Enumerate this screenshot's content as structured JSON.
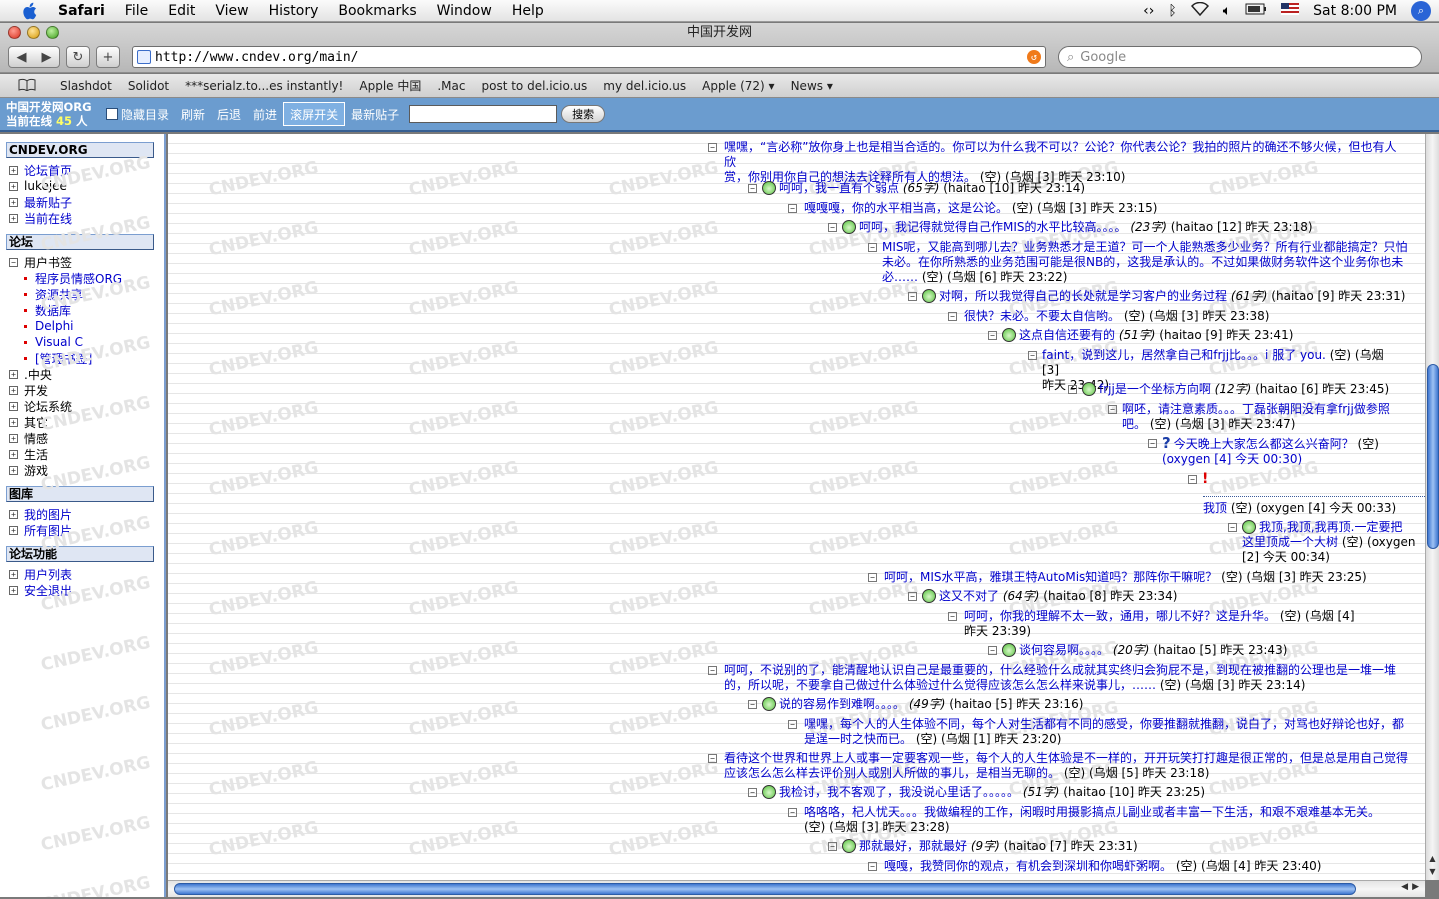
{
  "menubar": {
    "app": "Safari",
    "items": [
      "File",
      "Edit",
      "View",
      "History",
      "Bookmarks",
      "Window",
      "Help"
    ],
    "clock": "Sat 8:00 PM"
  },
  "window": {
    "title": "中国开发网"
  },
  "toolbar": {
    "url": "http://www.cndev.org/main/",
    "search_placeholder": "Google"
  },
  "bookmarks": [
    "Slashdot",
    "Solidot",
    "***serialz.to...es instantly!",
    "Apple 中国",
    ".Mac",
    "post to del.icio.us",
    "my del.icio.us",
    "Apple (72) ▾",
    "News ▾"
  ],
  "sitenav": {
    "brand_line1": "中国开发网ORG",
    "brand_pre": "当前在线",
    "online": "45",
    "brand_post": "人",
    "links": [
      {
        "label": "隐藏目录"
      },
      {
        "label": "刷新"
      },
      {
        "label": "后退"
      },
      {
        "label": "前进"
      },
      {
        "label": "滚屏开关"
      },
      {
        "label": "最新贴子"
      }
    ],
    "search_button": "搜索"
  },
  "sidebar": {
    "site": "CNDEV.ORG",
    "site_items": [
      "论坛首页",
      "lukejee",
      "最新贴子",
      "当前在线"
    ],
    "forum_title": "论坛",
    "bookmark_group": "用户书签",
    "bookmark_children": [
      "程序员情感ORG",
      "资源共享",
      "数据库",
      "Delphi",
      "Visual C",
      "[管理书签]"
    ],
    "forum_groups": [
      ".中央",
      "开发",
      "论坛系统",
      "其它",
      "情感",
      "生活",
      "游戏"
    ],
    "gallery_title": "图库",
    "gallery_items": [
      "我的图片",
      "所有图片"
    ],
    "func_title": "论坛功能",
    "func_items": [
      "用户列表",
      "安全退出"
    ]
  },
  "watermark": "CNDEV.ORG",
  "posts": [
    {
      "l1": "嘿嘿，“言必称”放你身上也是相当合适的。你可以为什么我不可以？公论？你代表公论？我拍的照片的确还不够火候，但也有人欣",
      "l2": "赏，你别用你自己的想法去诠释所有人的想法。",
      "meta": " (空) (乌烟 [3] 昨天 23:10)"
    },
    {
      "t": "呵呵，我一直有个弱点",
      "len": "(65字)",
      "meta": " (haitao [10] 昨天 23:14)"
    },
    {
      "t": "嘎嘎嘎，你的水平相当高，这是公论。",
      "meta": " (空) (乌烟 [3] 昨天 23:15)"
    },
    {
      "t": "呵呵，我记得就觉得自己作MIS的水平比较高。。。。",
      "len": "(23字)",
      "meta": " (haitao [12] 昨天 23:18)"
    },
    {
      "l1": "MIS呢，又能高到哪儿去？业务熟悉才是王道？可一个人能熟悉多少业务？所有行业都能搞定？只怕",
      "l2": "未必。在你所熟悉的业务范围可能是很NB的，这我是承认的。不过如果做财务软件这个业务你也未",
      "l3": "必……",
      "meta": " (空) (乌烟 [6] 昨天 23:22)"
    },
    {
      "t": "对啊，所以我觉得自己的长处就是学习客户的业务过程",
      "len": "(61字)",
      "meta": " (haitao [9] 昨天 23:31)"
    },
    {
      "t": "很快？未必。不要太自信哟。",
      "meta": " (空) (乌烟 [3] 昨天 23:38)"
    },
    {
      "t": "这点自信还要有的",
      "len": "(51字)",
      "meta": " (haitao [9] 昨天 23:41)"
    },
    {
      "t": "faint，说到这儿，居然拿自己和frjj比。。。i 服了 you.",
      "meta": " (空) (乌烟 [3]",
      "l2": "昨天 23:42)"
    },
    {
      "t": "frjj是一个坐标方向啊",
      "len": "(12字)",
      "meta": " (haitao [6] 昨天 23:45)"
    },
    {
      "t": "啊呸，请注意素质。。。丁磊张朝阳没有拿frjj做参照",
      "l2": "吧。",
      "meta": " (空) (乌烟 [3] 昨天 23:47)"
    },
    {
      "t": "今天晚上大家怎么都这么兴奋阿？",
      "meta": " (空)",
      "l2": "(oxygen [4] 今天 00:30)"
    },
    {
      "t": "我顶",
      "meta": " (空) (oxygen [4] 今天 00:33)"
    },
    {
      "t": "我顶,我顶,我再顶.一定要把",
      "l2t": "这里顶成一个大树",
      "meta": " (空) (oxygen",
      "l3": "[2] 今天 00:34)"
    },
    {
      "t": "呵呵，MIS水平高，雅琪王特AutoMis知道吗？那阵你干嘛呢？",
      "meta": " (空) (乌烟 [3] 昨天 23:25)"
    },
    {
      "t": "这又不对了",
      "len": "(64字)",
      "meta": " (haitao [8] 昨天 23:34)"
    },
    {
      "t": "呵呵，你我的理解不太一致，通用，哪儿不好？这是升华。",
      "meta": " (空) (乌烟 [4]",
      "l2": "昨天 23:39)"
    },
    {
      "t": "谈何容易啊。。。。",
      "len": "(20字)",
      "meta": " (haitao [5] 昨天 23:43)"
    },
    {
      "l1": "呵呵，不说别的了，能清醒地认识自己是最重要的，什么经验什么成就其实终归会狗屁不是，到现在被推翻的公理也是一堆一堆",
      "l2": "的，所以呢，不要拿自己做过什么体验过什么觉得应该怎么怎么样来说事儿，……",
      "meta": " (空) (乌烟 [3] 昨天 23:14)"
    },
    {
      "t": "说的容易作到难啊。。。。",
      "len": "(49字)",
      "meta": " (haitao [5] 昨天 23:16)"
    },
    {
      "l1": "嘿嘿，每个人的人生体验不同，每个人对生活都有不同的感受，你要推翻就推翻，说白了，对骂也好辩论也好，都",
      "l2": "是逞一时之快而已。",
      "meta": " (空) (乌烟 [1] 昨天 23:20)"
    },
    {
      "l1": "看待这个世界和世界上人或事一定要客观一些，每个人的人生体验是不一样的，开开玩笑打打趣是很正常的，但是总是用自己觉得",
      "l2": "应该怎么怎么样去评价别人或别人所做的事儿，是相当无聊的。",
      "meta": " (空) (乌烟 [5] 昨天 23:18)"
    },
    {
      "t": "我检讨，我不客观了，我没说心里话了。。。。。",
      "len": "(51字)",
      "meta": " (haitao [10] 昨天 23:25)"
    },
    {
      "t": "咯咯咯，杞人忧天。。。我做编程的工作，闲暇时用摄影搞点儿副业或者丰富一下生活，和艰不艰难基本无关。",
      "l2": "(空) (乌烟 [3] 昨天 23:28)"
    },
    {
      "t": "那就最好，那就最好",
      "len": "(9字)",
      "meta": " (haitao [7] 昨天 23:31)"
    },
    {
      "t": "嘎嘎，我赞同你的观点，有机会到深圳和你喝虾粥啊。",
      "meta": " (空) (乌烟 [4] 昨天 23:40)"
    }
  ]
}
